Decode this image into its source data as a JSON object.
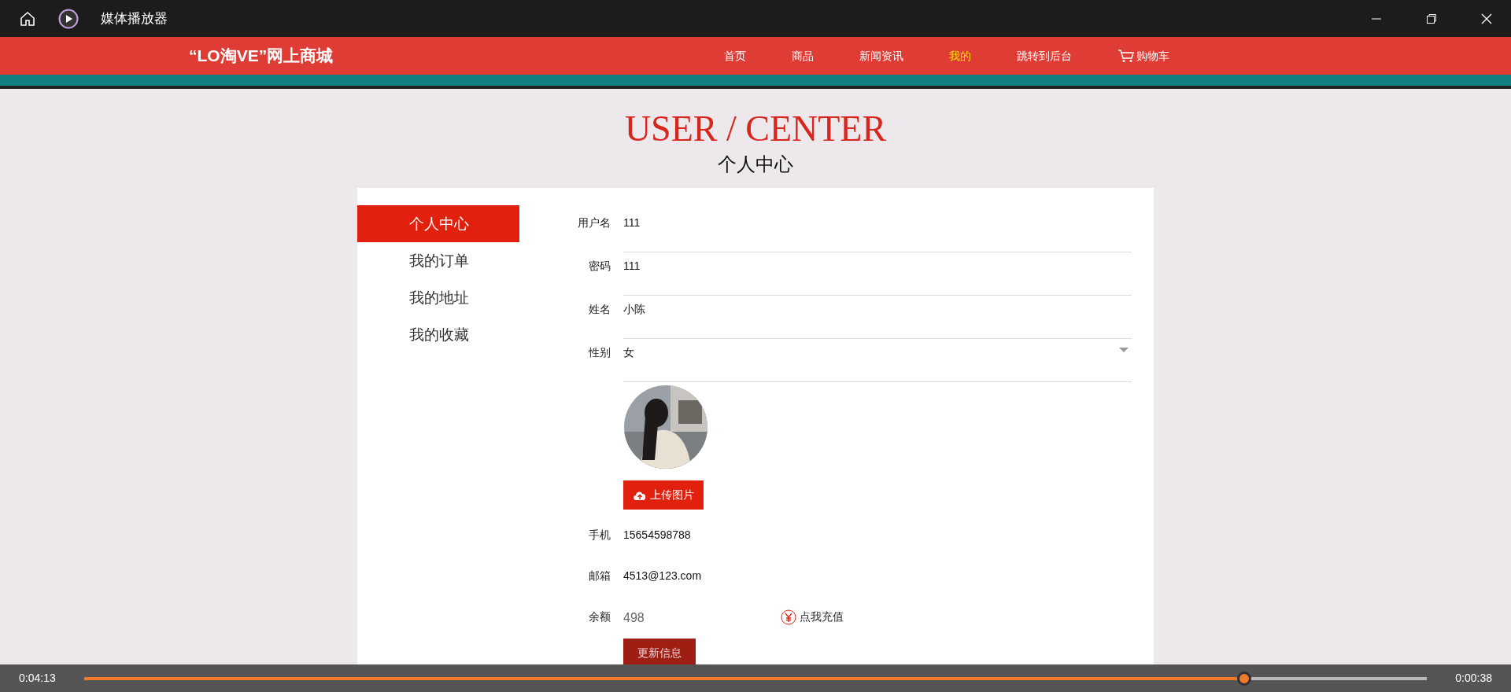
{
  "window": {
    "title": "媒体播放器"
  },
  "site": {
    "logo": "“LO淘VE”网上商城",
    "nav": [
      {
        "label": "首页",
        "selected": false
      },
      {
        "label": "商品",
        "selected": false
      },
      {
        "label": "新闻资讯",
        "selected": false
      },
      {
        "label": "我的",
        "selected": true
      },
      {
        "label": "跳转到后台",
        "selected": false
      }
    ],
    "cart": "购物车"
  },
  "heading": {
    "title": "USER / CENTER",
    "subtitle": "个人中心"
  },
  "sidebar": {
    "items": [
      {
        "label": "个人中心",
        "selected": true
      },
      {
        "label": "我的订单",
        "selected": false
      },
      {
        "label": "我的地址",
        "selected": false
      },
      {
        "label": "我的收藏",
        "selected": false
      }
    ]
  },
  "form": {
    "fields": [
      {
        "label": "用户名",
        "value": "111",
        "kind": "text"
      },
      {
        "label": "密码",
        "value": "111",
        "kind": "text"
      },
      {
        "label": "姓名",
        "value": "小陈",
        "kind": "text"
      },
      {
        "label": "性别",
        "value": "女",
        "kind": "select"
      }
    ],
    "upload_button": "上传图片",
    "contact_fields": [
      {
        "label": "手机",
        "value": "15654598788"
      },
      {
        "label": "邮箱",
        "value": "4513@123.com"
      }
    ],
    "balance": {
      "label": "余额",
      "value": "498",
      "recharge": "点我充值"
    },
    "submit": "更新信息"
  },
  "player": {
    "elapsed": "0:04:13",
    "remaining": "0:00:38",
    "level": 0.864
  }
}
